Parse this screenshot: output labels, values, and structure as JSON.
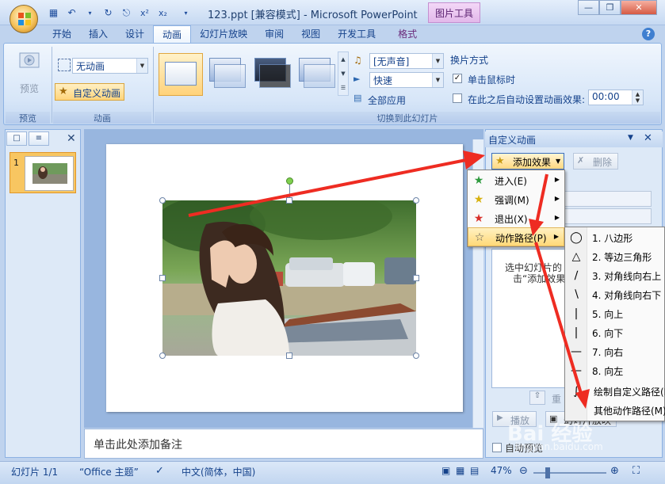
{
  "window": {
    "title": "123.ppt [兼容模式] - Microsoft PowerPoint",
    "context_tool": "图片工具"
  },
  "tabs": [
    "开始",
    "插入",
    "设计",
    "动画",
    "幻灯片放映",
    "审阅",
    "视图",
    "开发工具",
    "格式"
  ],
  "active_tab": "动画",
  "ribbon": {
    "preview_label": "预览",
    "preview_group": "预览",
    "animation_combo": "无动画",
    "custom_anim_btn": "自定义动画",
    "animation_group": "动画",
    "sound_combo": "[无声音]",
    "speed_combo": "快速",
    "apply_all": "全部应用",
    "transition_group": "切换到此幻灯片",
    "advance_title": "换片方式",
    "on_click": "单击鼠标时",
    "after_time": "在此之后自动设置动画效果:",
    "time_value": "00:00"
  },
  "left_pane": {
    "slide_number": "1"
  },
  "notes_placeholder": "单击此处添加备注",
  "task_pane": {
    "title": "自定义动画",
    "add_effect": "添加效果",
    "delete": "删除",
    "list_text_1": "选中幻灯片的",
    "list_text_2": "击“添加效果",
    "reorder": "重",
    "play": "播放",
    "slideshow": "幻灯片放映",
    "autopreview": "自动预览"
  },
  "effect_menu": [
    {
      "label": "进入(E)",
      "icon": "star-green-icon"
    },
    {
      "label": "强调(M)",
      "icon": "star-yellow-icon"
    },
    {
      "label": "退出(X)",
      "icon": "star-red-icon"
    },
    {
      "label": "动作路径(P)",
      "icon": "star-outline-icon"
    }
  ],
  "path_menu": [
    {
      "label": "1. 八边形",
      "icon": "octagon-icon"
    },
    {
      "label": "2. 等边三角形",
      "icon": "triangle-icon"
    },
    {
      "label": "3. 对角线向右上",
      "icon": "diag-up-icon"
    },
    {
      "label": "4. 对角线向右下",
      "icon": "diag-down-icon"
    },
    {
      "label": "5. 向上",
      "icon": "line-up-icon"
    },
    {
      "label": "6. 向下",
      "icon": "line-down-icon"
    },
    {
      "label": "7. 向右",
      "icon": "line-right-icon"
    },
    {
      "label": "8. 向左",
      "icon": "line-left-icon"
    },
    {
      "label": "绘制自定义路径(D)",
      "icon": "draw-path-icon"
    },
    {
      "label": "其他动作路径(M)...",
      "icon": ""
    }
  ],
  "status": {
    "slide": "幻灯片 1/1",
    "theme": "“Office 主题”",
    "language": "中文(简体，中国)",
    "zoom": "47%"
  },
  "watermark": {
    "brand": "Bai 经验",
    "url": "jingyan.baidu.com"
  },
  "colors": {
    "accent": "#15428b",
    "highlight": "#ffd978",
    "arrow": "#ee2c22"
  }
}
